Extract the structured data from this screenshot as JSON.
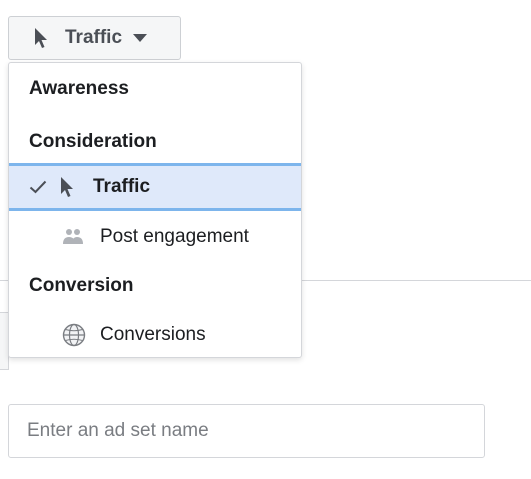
{
  "objective_button": {
    "label": "Traffic",
    "icon": "cursor-icon",
    "caret_icon": "caret-down-icon"
  },
  "menu": {
    "groups": [
      {
        "header": "Awareness",
        "items": []
      },
      {
        "header": "Consideration",
        "items": [
          {
            "label": "Traffic",
            "icon": "cursor-icon",
            "selected": true,
            "check_icon": "checkmark-icon"
          },
          {
            "label": "Post engagement",
            "icon": "people-icon",
            "selected": false
          }
        ]
      },
      {
        "header": "Conversion",
        "items": [
          {
            "label": "Conversions",
            "icon": "globe-icon",
            "selected": false
          }
        ]
      }
    ]
  },
  "adset_name": {
    "value": "",
    "placeholder": "Enter an ad set name"
  },
  "colors": {
    "selected_background": "#dfe9fa",
    "selected_border": "#7db5ec",
    "button_background": "#f5f6f7",
    "border": "#d4d6da",
    "text": "#1c1e21",
    "muted_text": "#7a7d82"
  }
}
